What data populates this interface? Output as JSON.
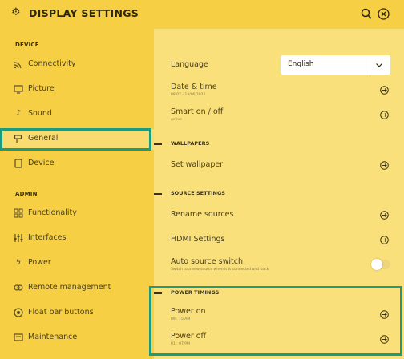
{
  "header": {
    "title": "DISPLAY SETTINGS",
    "icons": [
      "gear-icon",
      "search-icon",
      "close-icon"
    ]
  },
  "sidebar": {
    "device_heading": "DEVICE",
    "admin_heading": "ADMIN",
    "items": [
      {
        "label": "Connectivity",
        "icon": "wifi-icon"
      },
      {
        "label": "Picture",
        "icon": "monitor-icon"
      },
      {
        "label": "Sound",
        "icon": "music-note-icon"
      },
      {
        "label": "General",
        "icon": "sign-icon",
        "selected": true
      },
      {
        "label": "Device",
        "icon": "tablet-icon"
      },
      {
        "label": "Functionality",
        "icon": "grid-icon"
      },
      {
        "label": "Interfaces",
        "icon": "sliders-icon"
      },
      {
        "label": "Power",
        "icon": "bolt-icon"
      },
      {
        "label": "Remote management",
        "icon": "remote-icon"
      },
      {
        "label": "Float bar buttons",
        "icon": "float-bar-icon"
      },
      {
        "label": "Maintenance",
        "icon": "wrench-icon"
      }
    ]
  },
  "main": {
    "language": {
      "label": "Language",
      "value": "English"
    },
    "date_time": {
      "label": "Date & time",
      "sub": "08:07 - 14/06/2022"
    },
    "smart_onoff": {
      "label": "Smart on / off",
      "sub": "Active"
    },
    "wallpapers_heading": "WALLPAPERS",
    "set_wallpaper": {
      "label": "Set wallpaper"
    },
    "source_heading": "SOURCE SETTINGS",
    "rename_sources": {
      "label": "Rename sources"
    },
    "hdmi_settings": {
      "label": "HDMI Settings"
    },
    "auto_source": {
      "label": "Auto source switch",
      "sub": "Switch to a new source when it is connected and back",
      "enabled": false
    },
    "power_heading": "POWER TIMINGS",
    "power_on": {
      "label": "Power on",
      "sub": "09 : 15 AM"
    },
    "power_off": {
      "label": "Power off",
      "sub": "01 : 07 PM"
    }
  },
  "colors": {
    "sidebar_bg": "#f6cf45",
    "main_bg": "#fae07a",
    "highlight": "#1c9b80",
    "text": "#4a3f18"
  }
}
